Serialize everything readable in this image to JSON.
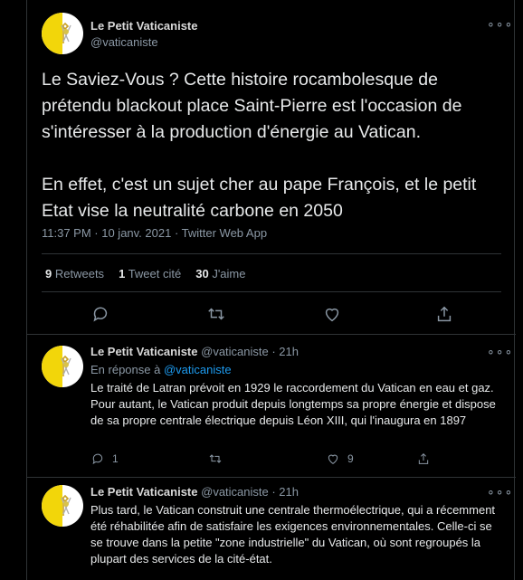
{
  "main_tweet": {
    "name": "Le Petit Vaticaniste",
    "handle": "@vaticaniste",
    "more": "∘∘∘",
    "text": "Le Saviez-Vous ? Cette histoire rocambolesque de prétendu blackout place Saint-Pierre est l'occasion de s'intéresser à la production d'énergie au Vatican.\n\nEn effet, c'est un sujet cher au pape François, et le petit Etat vise la neutralité carbone en 2050",
    "time": "11:37 PM · 10 janv. 2021 · Twitter Web App",
    "retweets_count": "9",
    "retweets_label": "Retweets",
    "quotes_count": "1",
    "quotes_label": "Tweet cité",
    "likes_count": "30",
    "likes_label": "J'aime"
  },
  "replies": [
    {
      "name": "Le Petit Vaticaniste",
      "handle": "@vaticaniste · 21h",
      "in_reply_prefix": "En réponse à",
      "in_reply_handle": "@vaticaniste",
      "text": "Le traité de Latran prévoit en 1929 le raccordement du Vatican en eau et gaz. Pour autant, le Vatican produit depuis longtemps sa propre énergie et dispose de sa propre centrale électrique depuis Léon XIII, qui l'inaugura en 1897",
      "reply_count": "1",
      "like_count": "9"
    },
    {
      "name": "Le Petit Vaticaniste",
      "handle": "@vaticaniste · 21h",
      "text": "Plus tard, le Vatican construit une centrale thermoélectrique, qui a récemment été réhabilitée afin de satisfaire les exigences environnementales. Celle-ci se se trouve dans la petite \"zone industrielle\" du Vatican, où sont regroupés la plupart des services de la cité-état."
    }
  ],
  "colors": {
    "background": "#000000",
    "accent": "#1d9bf0",
    "muted": "#8b98a5",
    "flag_yellow": "#f2d60a"
  },
  "icons": [
    "reply-icon",
    "retweet-icon",
    "like-icon",
    "share-icon",
    "more-icon"
  ]
}
